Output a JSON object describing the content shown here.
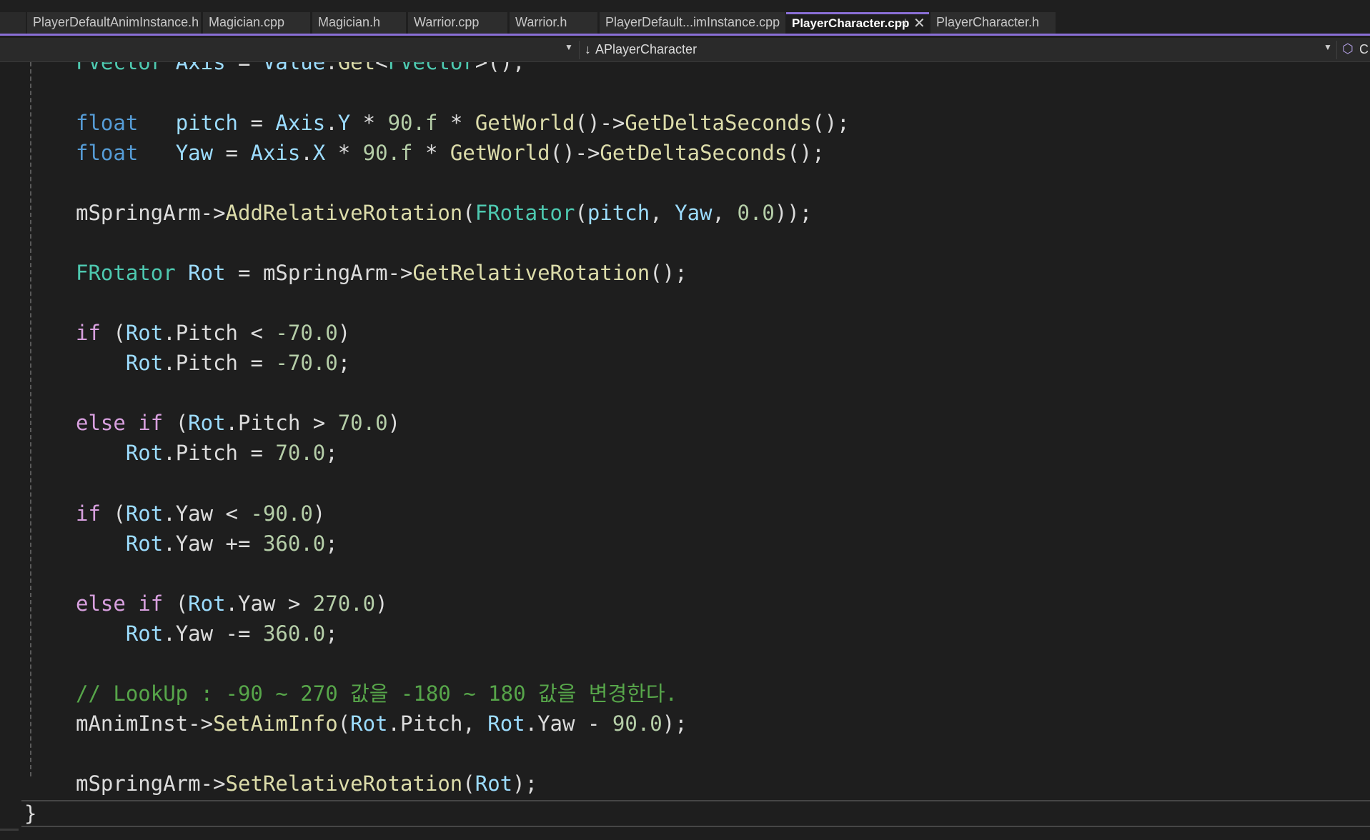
{
  "tabs": [
    {
      "label": "PlayerDefaultAnimInstance.h",
      "active": false
    },
    {
      "label": "Magician.cpp",
      "active": false
    },
    {
      "label": "Magician.h",
      "active": false
    },
    {
      "label": "Warrior.cpp",
      "active": false
    },
    {
      "label": "Warrior.h",
      "active": false
    },
    {
      "label": "PlayerDefault...imInstance.cpp",
      "active": false
    },
    {
      "label": "PlayerCharacter.cpp",
      "active": true,
      "pinned": true
    },
    {
      "label": "PlayerCharacter.h",
      "active": false
    }
  ],
  "icons": {
    "pin": "pin-icon",
    "close": "close-icon",
    "dropdown": "chevron-down-icon",
    "member_arrow": "down-arrow-icon",
    "class_cube": "cube-icon"
  },
  "navigation": {
    "member_scope": "APlayerCharacter",
    "right_partial": "C"
  },
  "colors": {
    "accent": "#8a6fd6",
    "editor_background": "#1e1e1e",
    "keyword": "#569cd6",
    "control_keyword": "#d8a0df",
    "variable": "#9cdcfe",
    "function": "#dcdcaa",
    "type": "#4ec9b0",
    "number": "#b5cea8",
    "comment": "#57a64a"
  },
  "code": {
    "l01": {
      "t1": "FVector",
      "t2": " ",
      "t3": "Axis",
      "t4": " = ",
      "t5": "Value",
      "t6": ".",
      "t7": "Get",
      "t8": "<",
      "t9": "FVector",
      "t10": ">();"
    },
    "l02": {
      "t1": "float",
      "t2": "   ",
      "t3": "pitch",
      "t4": " = ",
      "t5": "Axis",
      "t6": ".",
      "t7": "Y",
      "t8": " * ",
      "t9": "90.f",
      "t10": " * ",
      "t11": "GetWorld",
      "t12": "()->",
      "t13": "GetDeltaSeconds",
      "t14": "();"
    },
    "l03": {
      "t1": "float",
      "t2": "   ",
      "t3": "Yaw",
      "t4": " = ",
      "t5": "Axis",
      "t6": ".",
      "t7": "X",
      "t8": " * ",
      "t9": "90.f",
      "t10": " * ",
      "t11": "GetWorld",
      "t12": "()->",
      "t13": "GetDeltaSeconds",
      "t14": "();"
    },
    "l04": {
      "t1": "mSpringArm",
      "t2": "->",
      "t3": "AddRelativeRotation",
      "t4": "(",
      "t5": "FRotator",
      "t6": "(",
      "t7": "pitch",
      "t8": ", ",
      "t9": "Yaw",
      "t10": ", ",
      "t11": "0.0",
      "t12": "));"
    },
    "l05": {
      "t1": "FRotator",
      "t2": " ",
      "t3": "Rot",
      "t4": " = ",
      "t5": "mSpringArm",
      "t6": "->",
      "t7": "GetRelativeRotation",
      "t8": "();"
    },
    "l06": {
      "t1": "if",
      "t2": " (",
      "t3": "Rot",
      "t4": ".",
      "t5": "Pitch",
      "t6": " < ",
      "t7": "-70.0",
      "t8": ")"
    },
    "l07": {
      "t1": "    ",
      "t2": "Rot",
      "t3": ".",
      "t4": "Pitch",
      "t5": " = ",
      "t6": "-70.0",
      "t7": ";"
    },
    "l08": {
      "t1": "else",
      "t2": " ",
      "t3": "if",
      "t4": " (",
      "t5": "Rot",
      "t6": ".",
      "t7": "Pitch",
      "t8": " > ",
      "t9": "70.0",
      "t10": ")"
    },
    "l09": {
      "t1": "    ",
      "t2": "Rot",
      "t3": ".",
      "t4": "Pitch",
      "t5": " = ",
      "t6": "70.0",
      "t7": ";"
    },
    "l10": {
      "t1": "if",
      "t2": " (",
      "t3": "Rot",
      "t4": ".",
      "t5": "Yaw",
      "t6": " < ",
      "t7": "-90.0",
      "t8": ")"
    },
    "l11": {
      "t1": "    ",
      "t2": "Rot",
      "t3": ".",
      "t4": "Yaw",
      "t5": " += ",
      "t6": "360.0",
      "t7": ";"
    },
    "l12": {
      "t1": "else",
      "t2": " ",
      "t3": "if",
      "t4": " (",
      "t5": "Rot",
      "t6": ".",
      "t7": "Yaw",
      "t8": " > ",
      "t9": "270.0",
      "t10": ")"
    },
    "l13": {
      "t1": "    ",
      "t2": "Rot",
      "t3": ".",
      "t4": "Yaw",
      "t5": " -= ",
      "t6": "360.0",
      "t7": ";"
    },
    "l14": {
      "t1": "// LookUp : -90 ~ 270 값을 -180 ~ 180 값을 변경한다."
    },
    "l15": {
      "t1": "mAnimInst",
      "t2": "->",
      "t3": "SetAimInfo",
      "t4": "(",
      "t5": "Rot",
      "t6": ".",
      "t7": "Pitch",
      "t8": ", ",
      "t9": "Rot",
      "t10": ".",
      "t11": "Yaw",
      "t12": " - ",
      "t13": "90.0",
      "t14": ");"
    },
    "l16": {
      "t1": "mSpringArm",
      "t2": "->",
      "t3": "SetRelativeRotation",
      "t4": "(",
      "t5": "Rot",
      "t6": ");"
    },
    "l17": {
      "t1": "}"
    }
  }
}
